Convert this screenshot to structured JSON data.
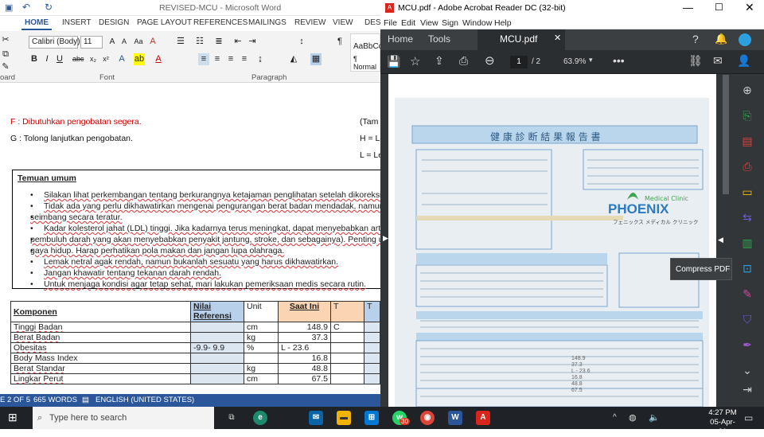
{
  "word": {
    "title": "REVISED-MCU - Microsoft Word",
    "file_tab": "LE",
    "tabs": [
      "HOME",
      "INSERT",
      "DESIGN",
      "PAGE LAYOUT",
      "REFERENCES",
      "MAILINGS",
      "REVIEW",
      "VIEW",
      "DES"
    ],
    "font_name": "Calibri (Body)",
    "font_size": "11",
    "style_preview": "AaBbCc",
    "style_name": "¶ Normal",
    "groups": [
      "oard",
      "Font",
      "Paragraph"
    ],
    "doc": {
      "lineF": "F : Dibutuhkan pengobatan segera.",
      "lineG": "G : Tolong lanjutkan pengobatan.",
      "rightA": "(Tam",
      "rightH": "H = Le",
      "rightL": "L = Le",
      "temuan_title": "Temuan umum",
      "bullets": [
        "Silakan lihat perkembangan tentang berkurangnya ketajaman penglihatan setelah dikoreksi.",
        "Tidak ada yang perlu dikhawatirkan mengenai pengurangan berat badan mendadak, namun sedapat",
        "seimbang secara teratur.",
        "Kadar kolesterol jahat (LDL) tinggi. Jika kadarnya terus meningkat, dapat menyebabkan arterisklero",
        "pembuluh darah yang akan menyebabkan penyakit jantung, stroke, dan sebagainya). Penting untuk s",
        "gaya hidup. Harap perhatikan pola makan dan jangan lupa olahraga.",
        "Lemak netral agak rendah, namun bukanlah sesuatu yang harus dikhawatirkan.",
        "Jangan khawatir tentang tekanan darah rendah.",
        "Untuk menjaga kondisi agar tetap sehat, mari lakukan pemeriksaan medis secara rutin."
      ],
      "table_headers": [
        "Komponen",
        "Nilai Referensi",
        "Unit",
        "Saat Ini",
        "T"
      ],
      "rows": [
        [
          "Tinggi Badan",
          "",
          "cm",
          "148.9",
          "C"
        ],
        [
          "Berat Badan",
          "",
          "kg",
          "37.3",
          ""
        ],
        [
          "Obesitas",
          "-9.9-   9.9",
          "%",
          "L   - 23.6",
          ""
        ],
        [
          "Body Mass Index",
          "",
          "",
          "16.8",
          ""
        ],
        [
          "Berat Standar",
          "",
          "kg",
          "48.8",
          ""
        ],
        [
          "Lingkar Perut",
          "",
          "cm",
          "67.5",
          ""
        ]
      ]
    },
    "status": {
      "page": "E 2 OF 5",
      "words": "665 WORDS",
      "lang": "ENGLISH (UNITED STATES)"
    }
  },
  "acrobat": {
    "title": "MCU.pdf - Adobe Acrobat Reader DC (32-bit)",
    "menu": [
      "File",
      "Edit",
      "View",
      "Sign",
      "Window",
      "Help"
    ],
    "tabs": [
      "Home",
      "Tools",
      "MCU.pdf"
    ],
    "page_current": "1",
    "page_total": "/ 2",
    "zoom": "63.9%",
    "tooltip": "Compress PDF",
    "report_title": "健 康 診 断 結 果 報 告 書",
    "clinic": "PHOENIX",
    "clinic_sub": "Medical Clinic",
    "clinic_jp": "フェニックス メディカル クリニック"
  },
  "taskbar": {
    "search": "Type here to search",
    "time": "4:27 PM",
    "date": "05-Apr-21",
    "badge": "30"
  }
}
